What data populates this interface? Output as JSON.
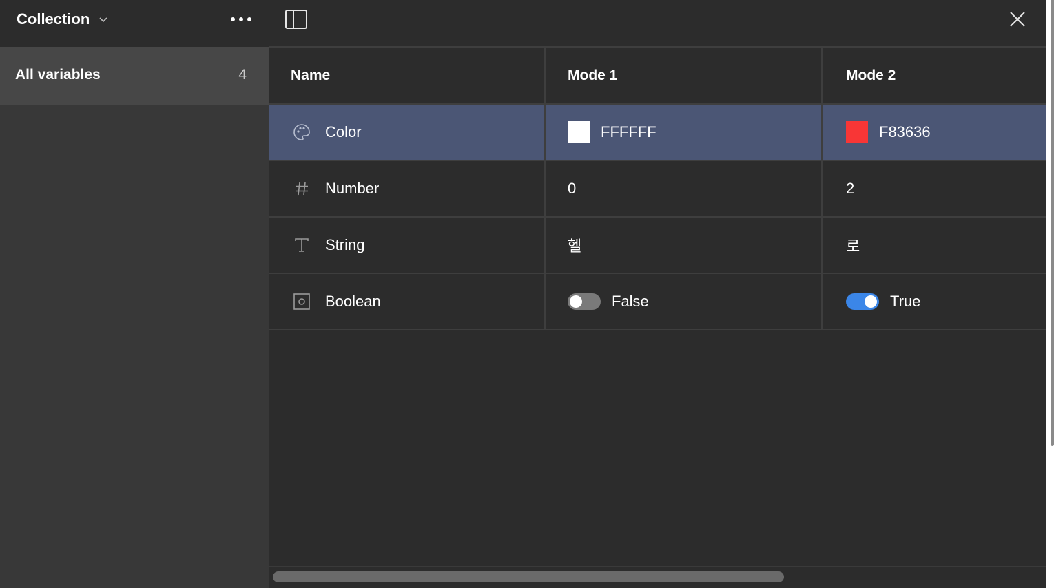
{
  "sidebar": {
    "collection_title": "Collection",
    "collection_chevron_icon": "chevron-down-icon",
    "more_icon": "more-horizontal-icon",
    "items": [
      {
        "label": "All variables",
        "count": "4"
      }
    ]
  },
  "toolbar": {
    "panel_toggle_icon": "sidebar-toggle-icon",
    "close_icon": "close-icon"
  },
  "table": {
    "columns": [
      "Name",
      "Mode 1",
      "Mode 2"
    ],
    "rows": [
      {
        "icon": "palette-icon",
        "name": "Color",
        "mode1": "FFFFFF",
        "mode1_color": "#FFFFFF",
        "mode2": "F83636",
        "mode2_color": "#F83636",
        "selected": true
      },
      {
        "icon": "hash-icon",
        "name": "Number",
        "mode1": "0",
        "mode2": "2"
      },
      {
        "icon": "text-type-icon",
        "name": "String",
        "mode1": "헬",
        "mode2": "로"
      },
      {
        "icon": "boolean-icon",
        "name": "Boolean",
        "mode1": "False",
        "mode1_on": false,
        "mode2": "True",
        "mode2_on": true
      }
    ]
  },
  "colors": {
    "selected_row": "#4B5675",
    "toggle_on": "#3B86E8",
    "toggle_off": "#7A7A7A",
    "sidebar_bg": "#383838",
    "panel_bg": "#2C2C2C"
  }
}
